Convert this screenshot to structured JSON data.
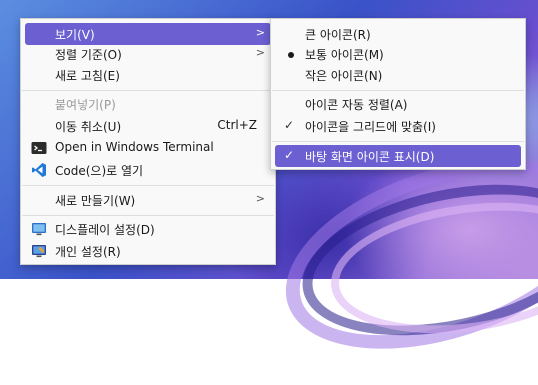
{
  "main_menu": {
    "view": "보기(V)",
    "sort_by": "정렬 기준(O)",
    "refresh": "새로 고침(E)",
    "paste": "붙여넣기(P)",
    "undo": "이동 취소(U)",
    "undo_shortcut": "Ctrl+Z",
    "open_terminal": "Open in Windows Terminal",
    "open_code": "Code(으)로 열기",
    "new": "새로 만들기(W)",
    "display_settings": "디스플레이 설정(D)",
    "personalize": "개인 설정(R)"
  },
  "sub_menu": {
    "large_icons": "큰 아이콘(R)",
    "medium_icons": "보통 아이콘(M)",
    "small_icons": "작은 아이콘(N)",
    "auto_arrange": "아이콘 자동 정렬(A)",
    "align_to_grid": "아이콘을 그리드에 맞춤(I)",
    "show_desktop_icons": "바탕 화면 아이콘 표시(D)"
  },
  "colors": {
    "highlight": "#6b5fd1",
    "menu_background": "#f9f9f9"
  },
  "icons": {
    "terminal": "terminal-icon",
    "vscode": "vscode-icon",
    "display": "display-icon",
    "personalize": "personalize-icon"
  }
}
